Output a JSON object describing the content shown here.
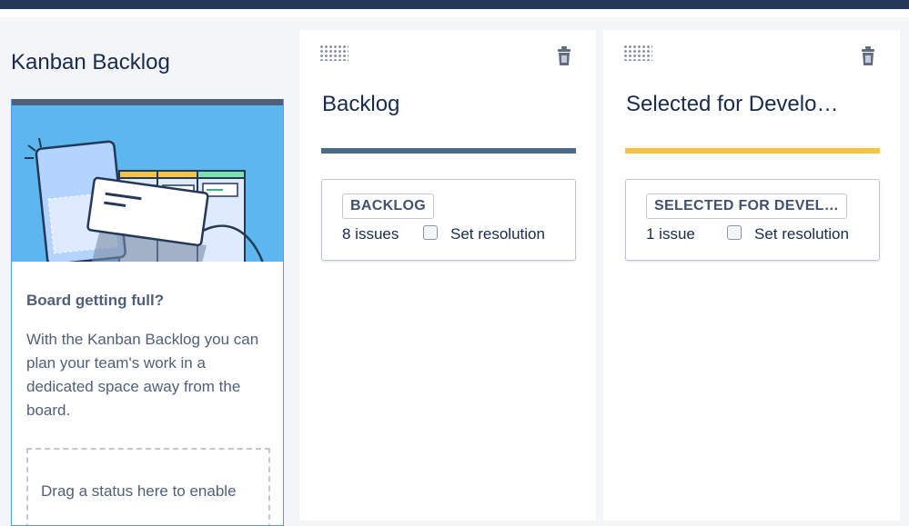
{
  "colors": {
    "topbar": "#253858",
    "backlog_bar": "#505f79",
    "column_backlog_bar": "#4a6a8a",
    "column_selected_bar": "#f6c342",
    "illustration_bg": "#5cb7ef"
  },
  "kanban_backlog": {
    "title": "Kanban Backlog",
    "heading": "Board getting full?",
    "description": "With the Kanban Backlog you can plan your team's work in a dedicated space away from the board.",
    "drop_hint": "Drag a status here to enable"
  },
  "columns": [
    {
      "title": "Backlog",
      "status_label": "BACKLOG",
      "issues": "8 issues",
      "resolution_label": "Set resolution",
      "resolution_checked": false
    },
    {
      "title": "Selected for Develo…",
      "status_label": "SELECTED FOR DEVEL…",
      "issues": "1 issue",
      "resolution_label": "Set resolution",
      "resolution_checked": false
    }
  ],
  "icons": {
    "drag": "drag-handle-icon",
    "delete": "trash-icon"
  }
}
